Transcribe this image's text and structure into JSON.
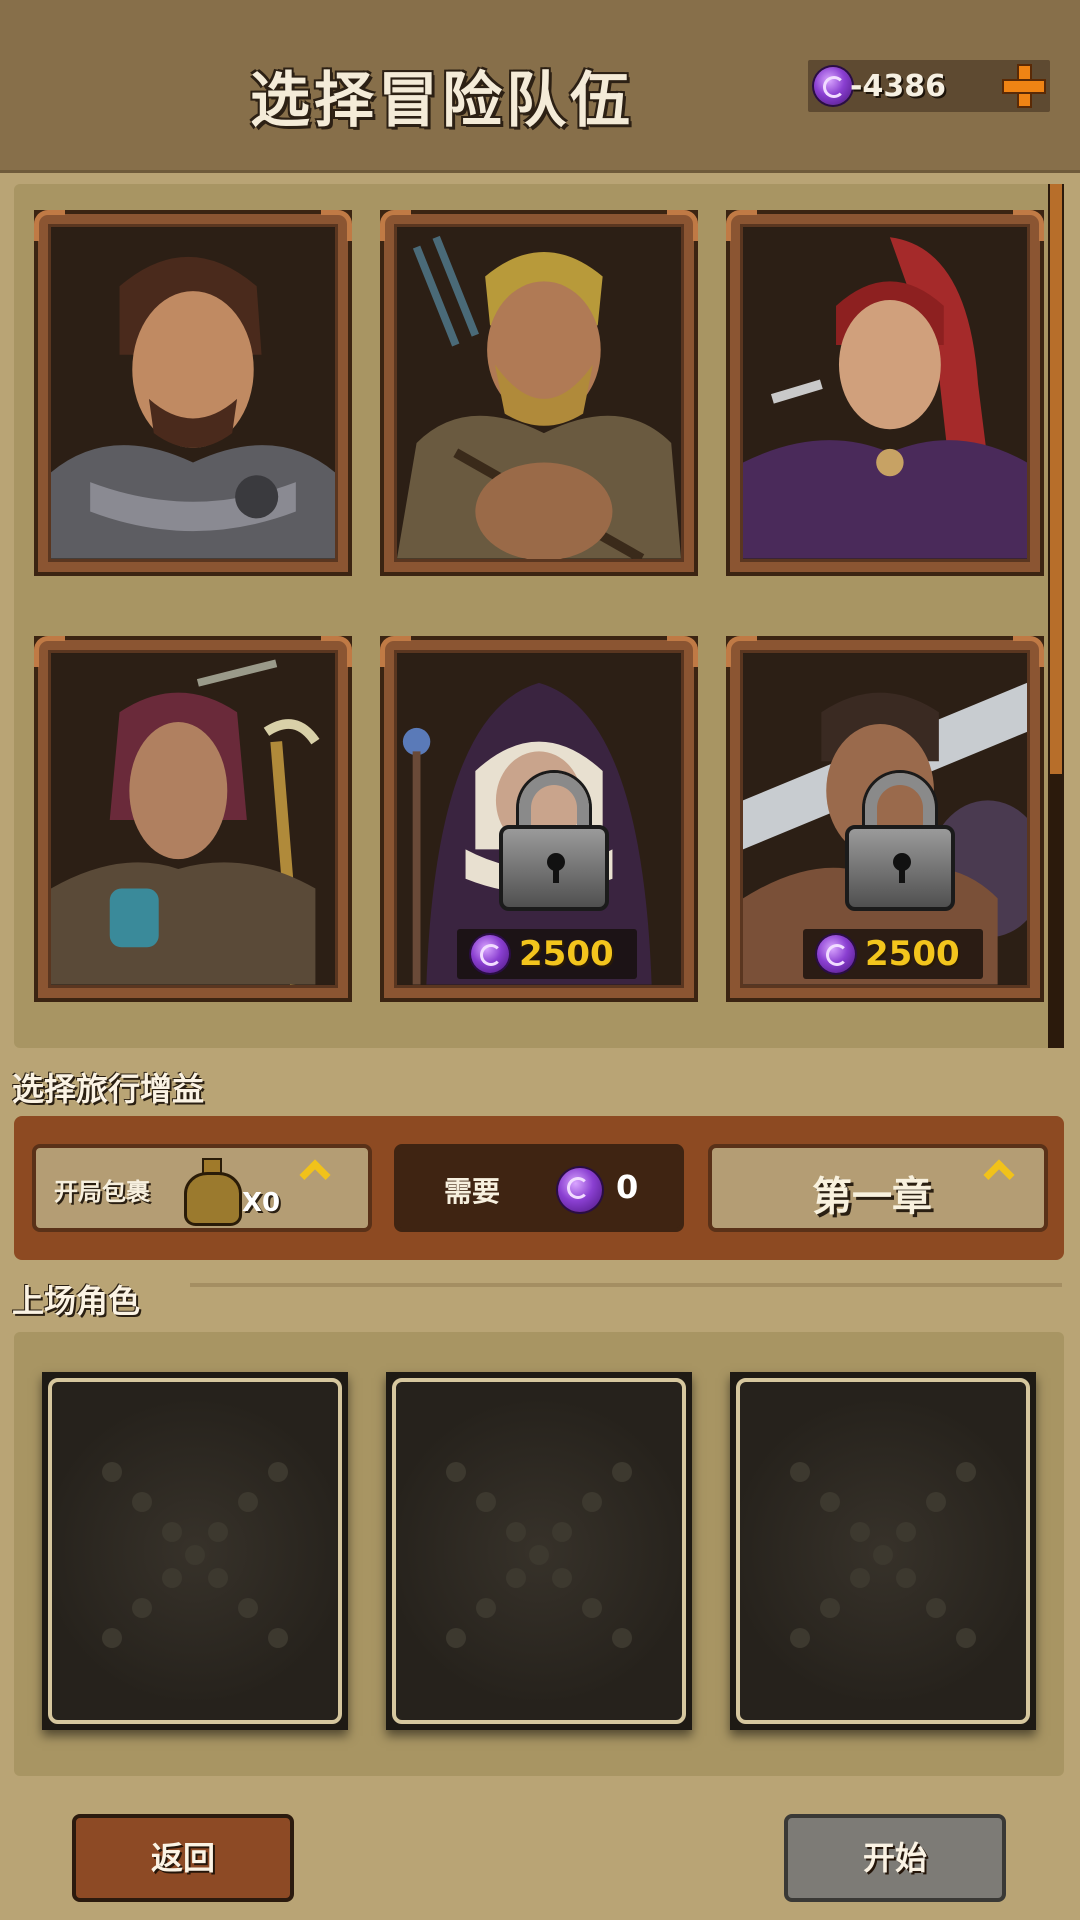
{
  "header": {
    "title": "选择冒险队伍",
    "currency": {
      "icon": "gem-icon",
      "value": "-4386"
    },
    "add_button_icon": "plus-icon"
  },
  "roster": {
    "heroes": [
      {
        "portrait": "armored-warrior-portrait",
        "locked": false
      },
      {
        "portrait": "bearded-archer-portrait",
        "locked": false
      },
      {
        "portrait": "red-haired-rogue-portrait",
        "locked": false
      },
      {
        "portrait": "feathered-shaman-portrait",
        "locked": false
      },
      {
        "portrait": "hooded-nun-portrait",
        "locked": true,
        "price": "2500"
      },
      {
        "portrait": "greatsword-warrior-portrait",
        "locked": true,
        "price": "2500"
      }
    ]
  },
  "buffs": {
    "section_label": "选择旅行增益",
    "pack_label": "开局包裹",
    "pack_count": "X0",
    "cost_label": "需要",
    "cost_value": "0",
    "chapter_label": "第一章"
  },
  "party": {
    "section_label": "上场角色",
    "slots": [
      "empty",
      "empty",
      "empty"
    ]
  },
  "buttons": {
    "back": "返回",
    "start": "开始"
  },
  "colors": {
    "background": "#b9a475",
    "header": "#876f4a",
    "gem": "#8a3fd1",
    "price_text": "#f3c51d",
    "plus": "#f08414"
  }
}
